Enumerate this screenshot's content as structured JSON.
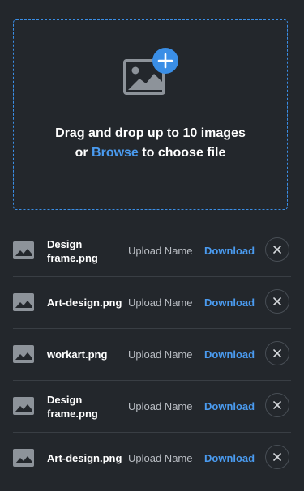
{
  "dropzone": {
    "line1": "Drag and drop up to 10 images",
    "line2_prefix": "or ",
    "browse_label": "Browse",
    "line2_suffix": " to choose file",
    "icon": "image-add-icon"
  },
  "files": [
    {
      "name": "Design frame.png",
      "upload_label": "Upload Name",
      "download_label": "Download"
    },
    {
      "name": "Art-design.png",
      "upload_label": "Upload Name",
      "download_label": "Download"
    },
    {
      "name": "workart.png",
      "upload_label": "Upload Name",
      "download_label": "Download"
    },
    {
      "name": "Design frame.png",
      "upload_label": "Upload Name",
      "download_label": "Download"
    },
    {
      "name": "Art-design.png",
      "upload_label": "Upload Name",
      "download_label": "Download"
    }
  ],
  "colors": {
    "accent": "#4a9bf0",
    "background": "#23272c",
    "divider": "#393e44"
  }
}
